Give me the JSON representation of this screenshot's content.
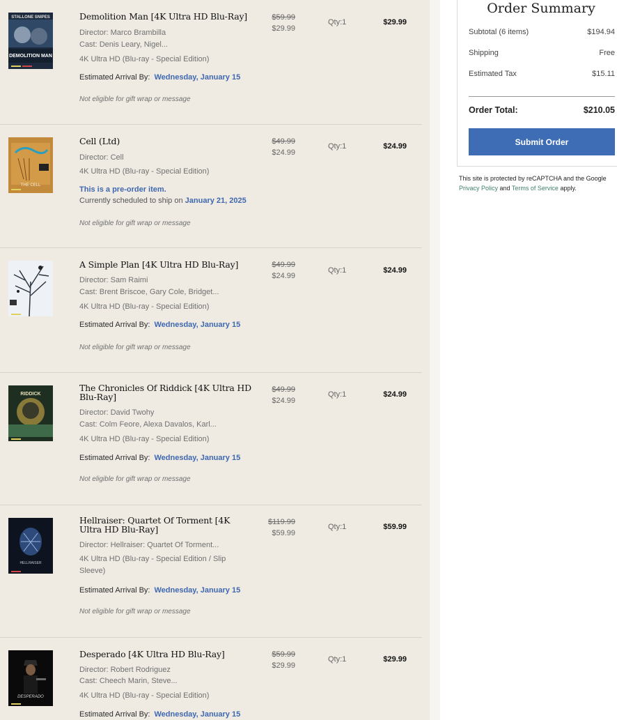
{
  "items": [
    {
      "title": "Demolition Man [4K Ultra HD Blu-Ray]",
      "director": "Director: Marco Brambilla",
      "cast": "Cast: Denis Leary, Nigel...",
      "format": "4K Ultra HD (Blu-ray - Special Edition)",
      "arrival_label": "Estimated Arrival By:",
      "arrival_date": "Wednesday, January 15",
      "giftwrap": "Not eligible for gift wrap or message",
      "was_price": "$59.99",
      "price": "$29.99",
      "qty": "Qty:1",
      "total": "$29.99",
      "cover_text_top": "STALLONE SNIPES",
      "cover_text_bottom": "DEMOLITION MAN"
    },
    {
      "title": "Cell (Ltd)",
      "director": "Director: Cell",
      "format": "4K Ultra HD (Blu-ray - Special Edition)",
      "preorder_note": "This is a pre-order item.",
      "ship_prefix": "Currently scheduled to ship on",
      "ship_date": "January 21, 2025",
      "giftwrap": "Not eligible for gift wrap or message",
      "was_price": "$49.99",
      "price": "$24.99",
      "qty": "Qty:1",
      "total": "$24.99",
      "cover_text_bottom": "THE CELL"
    },
    {
      "title": "A Simple Plan [4K Ultra HD Blu-Ray]",
      "director": "Director: Sam Raimi",
      "cast": "Cast: Brent Briscoe, Gary Cole, Bridget...",
      "format": "4K Ultra HD (Blu-ray - Special Edition)",
      "arrival_label": "Estimated Arrival By:",
      "arrival_date": "Wednesday, January 15",
      "giftwrap": "Not eligible for gift wrap or message",
      "was_price": "$49.99",
      "price": "$24.99",
      "qty": "Qty:1",
      "total": "$24.99"
    },
    {
      "title": "The Chronicles Of Riddick [4K Ultra HD Blu-Ray]",
      "director": "Director: David Twohy",
      "cast": "Cast: Colm Feore, Alexa Davalos, Karl...",
      "format": "4K Ultra HD (Blu-ray - Special Edition)",
      "arrival_label": "Estimated Arrival By:",
      "arrival_date": "Wednesday, January 15",
      "giftwrap": "Not eligible for gift wrap or message",
      "was_price": "$49.99",
      "price": "$24.99",
      "qty": "Qty:1",
      "total": "$24.99",
      "cover_text_top": "RIDDICK"
    },
    {
      "title": "Hellraiser: Quartet Of Torment [4K Ultra HD Blu-Ray]",
      "director": "Director: Hellraiser: Quartet Of Torment...",
      "format": "4K Ultra HD (Blu-ray - Special Edition / Slip Sleeve)",
      "arrival_label": "Estimated Arrival By:",
      "arrival_date": "Wednesday, January 15",
      "giftwrap": "Not eligible for gift wrap or message",
      "was_price": "$119.99",
      "price": "$59.99",
      "qty": "Qty:1",
      "total": "$59.99",
      "cover_text_bottom": "HELLRAISER"
    },
    {
      "title": "Desperado [4K Ultra HD Blu-Ray]",
      "director": "Director: Robert Rodriguez",
      "cast": "Cast: Cheech Marin, Steve...",
      "format": "4K Ultra HD (Blu-ray - Special Edition)",
      "arrival_label": "Estimated Arrival By:",
      "arrival_date": "Wednesday, January 15",
      "was_price": "$59.99",
      "price": "$29.99",
      "qty": "Qty:1",
      "total": "$29.99",
      "cover_text_bottom": "DESPERADO"
    }
  ],
  "summary": {
    "title": "Order Summary",
    "subtotal_label": "Subtotal (6 items)",
    "subtotal_value": "$194.94",
    "shipping_label": "Shipping",
    "shipping_value": "Free",
    "tax_label": "Estimated Tax",
    "tax_value": "$15.11",
    "total_label": "Order Total:",
    "total_value": "$210.05",
    "submit_label": "Submit Order"
  },
  "recaptcha": {
    "text": "This site is protected by reCAPTCHA and the Google",
    "privacy_link": "Privacy Policy",
    "and_text": "and",
    "terms_link": "Terms of Service",
    "apply_text": "apply."
  },
  "colors": {
    "accent": "#3e6db5",
    "link": "#3f68b0",
    "panel_bg": "#efebe3"
  },
  "icons": [
    "movie-cover-image"
  ]
}
